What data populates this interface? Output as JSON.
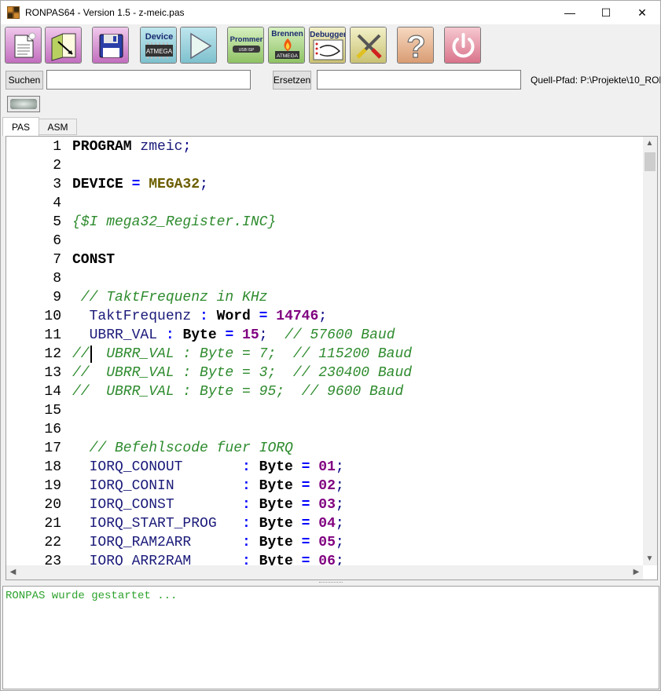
{
  "window": {
    "title": "RONPAS64 - Version 1.5 - z-meic.pas",
    "controls": {
      "minimize": "—",
      "maximize": "☐",
      "close": "✕"
    }
  },
  "toolbar": {
    "buttons": [
      {
        "id": "new-file",
        "icon": "new-document-icon"
      },
      {
        "id": "open-file",
        "icon": "open-folder-icon"
      },
      {
        "id": "save-file",
        "icon": "floppy-disk-icon"
      },
      {
        "id": "device",
        "icon": "device-chip-icon",
        "label": "Device",
        "sublabel": "ATMEGA"
      },
      {
        "id": "run",
        "icon": "play-icon"
      },
      {
        "id": "prommer",
        "icon": "usb-programmer-icon",
        "label": "Prommer",
        "sublabel": "USB ISP"
      },
      {
        "id": "brennen",
        "icon": "burn-chip-icon",
        "label": "Brennen",
        "sublabel": "ATMEGA"
      },
      {
        "id": "debugger",
        "icon": "debugger-icon",
        "label": "Debugger"
      },
      {
        "id": "tools",
        "icon": "tools-icon"
      },
      {
        "id": "help",
        "icon": "question-mark-icon",
        "label": "?"
      },
      {
        "id": "exit",
        "icon": "power-icon"
      }
    ]
  },
  "search": {
    "search_button": "Suchen",
    "search_value": "",
    "replace_button": "Ersetzen",
    "replace_value": "",
    "path_label": "Quell-Pfad: P:\\Projekte\\10_RON"
  },
  "tabs": [
    {
      "label": "PAS",
      "active": true
    },
    {
      "label": "ASM",
      "active": false
    }
  ],
  "editor": {
    "lines": [
      {
        "n": "1",
        "tokens": [
          [
            "kw",
            "PROGRAM"
          ],
          [
            "id",
            " zmeic"
          ],
          [
            "pn",
            ";"
          ]
        ]
      },
      {
        "n": "2",
        "tokens": []
      },
      {
        "n": "3",
        "tokens": [
          [
            "kw",
            "DEVICE"
          ],
          [
            "op",
            " = "
          ],
          [
            "ty",
            "MEGA32"
          ],
          [
            "pn",
            ";"
          ]
        ]
      },
      {
        "n": "4",
        "tokens": []
      },
      {
        "n": "5",
        "tokens": [
          [
            "cm",
            "{$I mega32_Register.INC}"
          ]
        ]
      },
      {
        "n": "6",
        "tokens": []
      },
      {
        "n": "7",
        "tokens": [
          [
            "kw",
            "CONST"
          ]
        ]
      },
      {
        "n": "8",
        "tokens": []
      },
      {
        "n": "9",
        "tokens": [
          [
            "cm",
            " // TaktFrequenz in KHz"
          ]
        ]
      },
      {
        "n": "10",
        "tokens": [
          [
            "id",
            "  TaktFrequenz"
          ],
          [
            "op",
            " : "
          ],
          [
            "kw",
            "Word"
          ],
          [
            "op",
            " = "
          ],
          [
            "num",
            "14746"
          ],
          [
            "pn",
            ";"
          ]
        ]
      },
      {
        "n": "11",
        "tokens": [
          [
            "id",
            "  UBRR_VAL"
          ],
          [
            "op",
            " : "
          ],
          [
            "kw",
            "Byte"
          ],
          [
            "op",
            " = "
          ],
          [
            "num",
            "15"
          ],
          [
            "pn",
            ";"
          ],
          [
            "cm",
            "  // 57600 Baud"
          ]
        ]
      },
      {
        "n": "12",
        "tokens": [
          [
            "cm",
            "//  UBRR_VAL : Byte = 7;  // 115200 Baud"
          ]
        ]
      },
      {
        "n": "13",
        "tokens": [
          [
            "cm",
            "//  UBRR_VAL : Byte = 3;  // 230400 Baud"
          ]
        ]
      },
      {
        "n": "14",
        "tokens": [
          [
            "cm",
            "//  UBRR_VAL : Byte = 95;  // 9600 Baud"
          ]
        ]
      },
      {
        "n": "15",
        "tokens": []
      },
      {
        "n": "16",
        "tokens": []
      },
      {
        "n": "17",
        "tokens": [
          [
            "cm",
            "  // Befehlscode fuer IORQ"
          ]
        ]
      },
      {
        "n": "18",
        "tokens": [
          [
            "id",
            "  IORQ_CONOUT      "
          ],
          [
            "op",
            " : "
          ],
          [
            "kw",
            "Byte"
          ],
          [
            "op",
            " = "
          ],
          [
            "num",
            "01"
          ],
          [
            "pn",
            ";"
          ]
        ]
      },
      {
        "n": "19",
        "tokens": [
          [
            "id",
            "  IORQ_CONIN       "
          ],
          [
            "op",
            " : "
          ],
          [
            "kw",
            "Byte"
          ],
          [
            "op",
            " = "
          ],
          [
            "num",
            "02"
          ],
          [
            "pn",
            ";"
          ]
        ]
      },
      {
        "n": "20",
        "tokens": [
          [
            "id",
            "  IORQ_CONST       "
          ],
          [
            "op",
            " : "
          ],
          [
            "kw",
            "Byte"
          ],
          [
            "op",
            " = "
          ],
          [
            "num",
            "03"
          ],
          [
            "pn",
            ";"
          ]
        ]
      },
      {
        "n": "21",
        "tokens": [
          [
            "id",
            "  IORQ_START_PROG  "
          ],
          [
            "op",
            " : "
          ],
          [
            "kw",
            "Byte"
          ],
          [
            "op",
            " = "
          ],
          [
            "num",
            "04"
          ],
          [
            "pn",
            ";"
          ]
        ]
      },
      {
        "n": "22",
        "tokens": [
          [
            "id",
            "  IORQ_RAM2ARR     "
          ],
          [
            "op",
            " : "
          ],
          [
            "kw",
            "Byte"
          ],
          [
            "op",
            " = "
          ],
          [
            "num",
            "05"
          ],
          [
            "pn",
            ";"
          ]
        ]
      },
      {
        "n": "23",
        "tokens": [
          [
            "id",
            "  IORQ_ARR2RAM     "
          ],
          [
            "op",
            " : "
          ],
          [
            "kw",
            "Byte"
          ],
          [
            "op",
            " = "
          ],
          [
            "num",
            "06"
          ],
          [
            "pn",
            ";"
          ]
        ]
      }
    ]
  },
  "log": {
    "text": "RONPAS wurde gestartet ..."
  },
  "colors": {
    "keyword": "#000000",
    "identifier": "#1a1a7a",
    "type": "#6b5e00",
    "operator": "#0000ff",
    "number": "#800080",
    "comment": "#2e8b2e",
    "log_text": "#2ea32e"
  }
}
